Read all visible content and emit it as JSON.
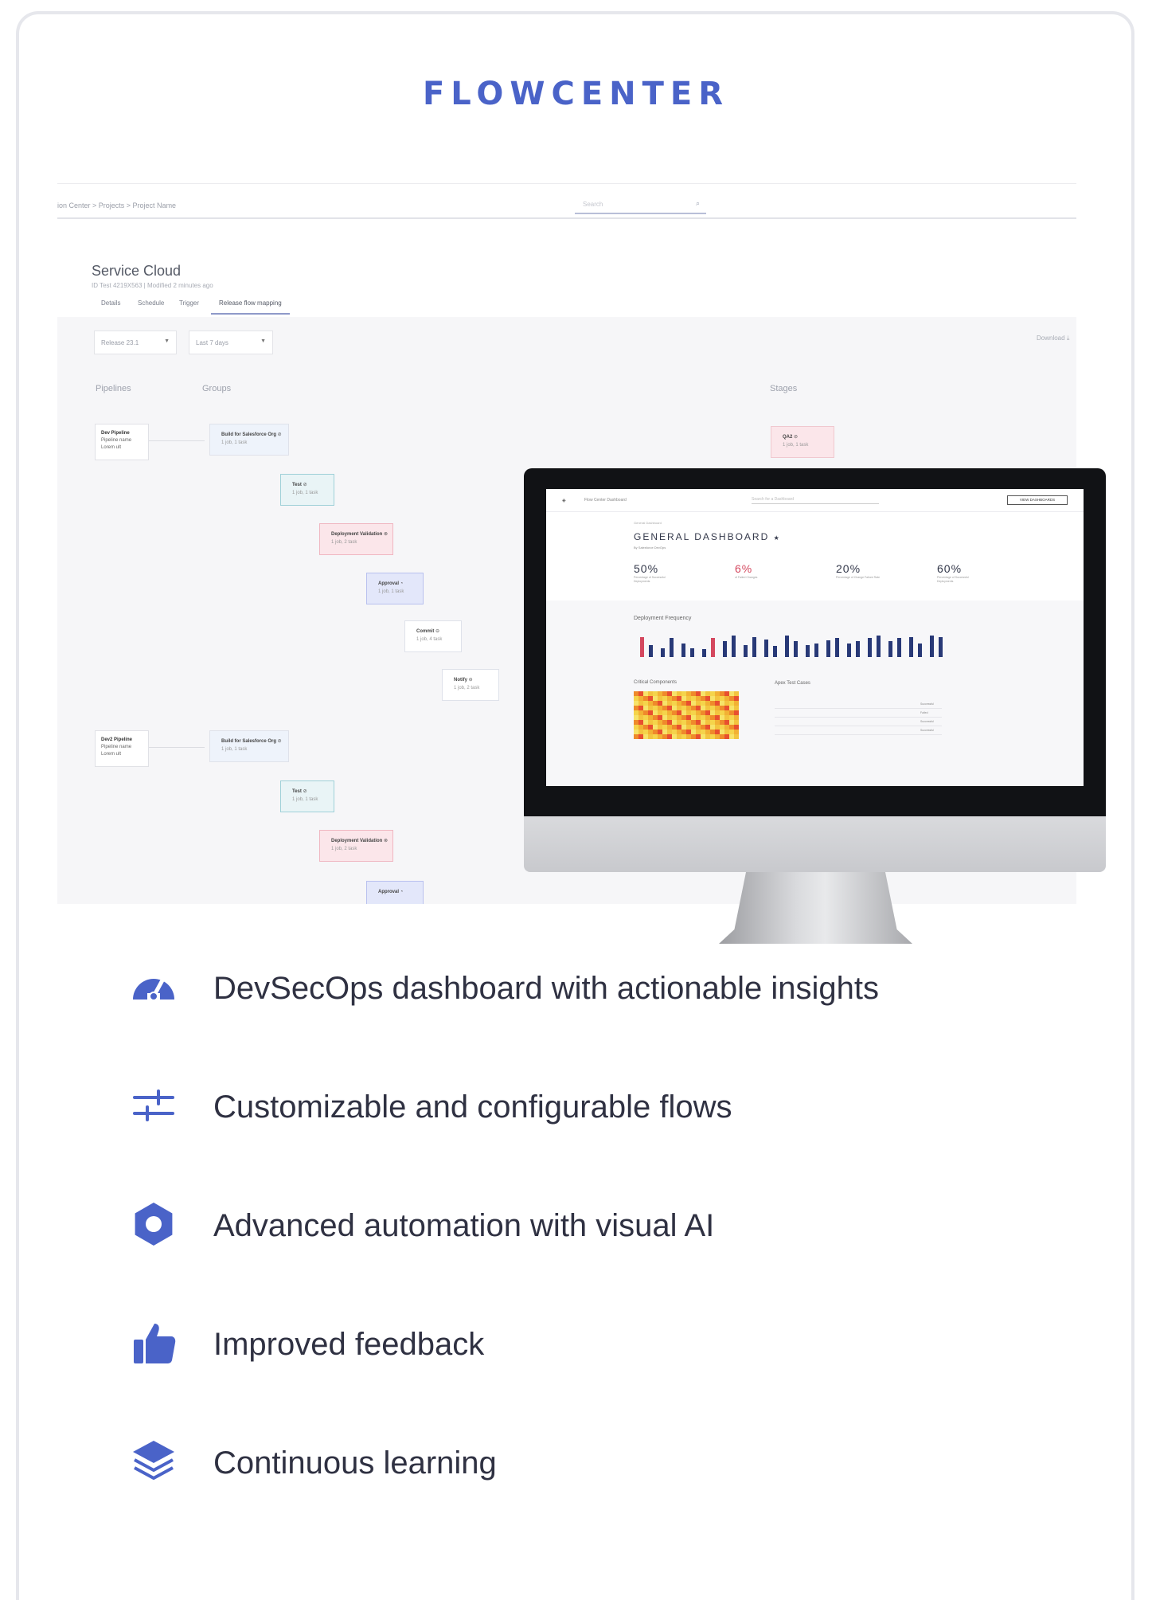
{
  "brand": "FLOWCENTER",
  "screenshot": {
    "breadcrumb": "ion Center > Projects > Project Name",
    "search_placeholder": "Search",
    "title": "Service Cloud",
    "subtitle": "ID Test 4219X563 | Modified 2 minutes ago",
    "tabs": [
      "Details",
      "Schedule",
      "Trigger",
      "Release flow mapping"
    ],
    "filters": [
      "Release 23.1",
      "Last 7 days"
    ],
    "download": "Download",
    "columns": [
      "Pipelines",
      "Groups",
      "Stages"
    ],
    "pipelines": [
      {
        "name": "Dev Pipeline",
        "sub1": "Pipeline name",
        "sub2": "Lorem ult"
      },
      {
        "name": "Dev2 Pipeline",
        "sub1": "Pipeline name",
        "sub2": "Lorem ult"
      }
    ],
    "nodes": [
      {
        "label": "Build for Salesforce Org",
        "sub": "1 job, 1 task"
      },
      {
        "label": "Test",
        "sub": "1 job, 1 task"
      },
      {
        "label": "Deployment Validation",
        "sub": "1 job, 2 task"
      },
      {
        "label": "Approval",
        "sub": "1 job, 1 task"
      },
      {
        "label": "Commit",
        "sub": "1 job, 4 task"
      },
      {
        "label": "Notify",
        "sub": "1 job, 2 task"
      },
      {
        "label": "Build for Salesforce Org",
        "sub": "1 job, 1 task"
      },
      {
        "label": "Test",
        "sub": "1 job, 1 task"
      },
      {
        "label": "Deployment Validation",
        "sub": "1 job, 2 task"
      },
      {
        "label": "Approval",
        "sub": ""
      }
    ],
    "stage_node": {
      "label": "QA2",
      "sub": "1 job, 1 task"
    }
  },
  "monitor": {
    "app_title": "Flow Center Dashboard",
    "search_placeholder": "Search for a Dashboard",
    "button": "VIEW DASHBOARDS",
    "crumb": "General Dashboard",
    "dashboard_title": "GENERAL DASHBOARD",
    "star": "★",
    "by_line": "By  Salesforce  DevOps",
    "kpis": [
      "50%",
      "6%",
      "20%",
      "60%"
    ],
    "kpi_captions": [
      "Percentage of Successful Deployments",
      "of Failed Changes",
      "Percentage of Change Failure Rate",
      "Percentage of Successful Deployments"
    ],
    "deployment_frequency_title": "Deployment Frequency",
    "bar_values": [
      0.9,
      0.55,
      0.4,
      0.85,
      0.6,
      0.4,
      0.35,
      0.85,
      0.7,
      0.95,
      0.55,
      0.9,
      0.8,
      0.5,
      0.95,
      0.7,
      0.55,
      0.6,
      0.75,
      0.85,
      0.6,
      0.7,
      0.85,
      0.95,
      0.7,
      0.85,
      0.9,
      0.6,
      0.95,
      0.9
    ],
    "red_bars": [
      0,
      7
    ],
    "critical_components_title": "Critical Components",
    "apex_title": "Apex Test Cases",
    "apex_statuses": [
      "Successful",
      "Failed",
      "Successful",
      "Successful"
    ]
  },
  "features": [
    {
      "icon": "speedometer-icon",
      "label": "DevSecOps dashboard with actionable insights"
    },
    {
      "icon": "sliders-icon",
      "label": "Customizable and configurable flows"
    },
    {
      "icon": "gear-icon",
      "label": "Advanced automation with visual AI"
    },
    {
      "icon": "thumbs-up-icon",
      "label": "Improved feedback"
    },
    {
      "icon": "layers-icon",
      "label": "Continuous learning"
    }
  ],
  "colors": {
    "brand": "#4a63c8",
    "icon": "#4a63c8",
    "text": "#2f3142",
    "bar": "#283977",
    "bar_alert": "#d4485f"
  }
}
